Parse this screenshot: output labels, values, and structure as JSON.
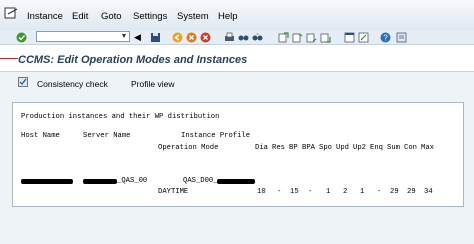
{
  "menubar": {
    "items": [
      "Instance",
      "Edit",
      "Goto",
      "Settings",
      "System",
      "Help"
    ]
  },
  "toolbar": {
    "command_field_value": ""
  },
  "title": "CCMS: Edit Operation Modes and Instances",
  "app_toolbar": {
    "consistency_check": "Consistency check",
    "profile_view": "Profile view"
  },
  "list": {
    "heading": "Production instances and their WP distribution",
    "col_host": "Host Name",
    "col_server": "Server Name",
    "col_instance_profile": "Instance Profile",
    "col_operation_mode": "Operation Mode",
    "wp_headers": [
      "Dia",
      "Res",
      "BP",
      "BPA",
      "Spo",
      "Upd",
      "Up2",
      "Enq",
      "Sum",
      "Con",
      "Max"
    ],
    "row": {
      "server_suffix": "_QAS_00",
      "profile_prefix": "QAS_D00_",
      "operation_mode": "DAYTIME",
      "values": [
        "10",
        "-",
        "15",
        "-",
        "1",
        "2",
        "1",
        "-",
        "29",
        "29",
        "34"
      ]
    }
  },
  "colors": {
    "title": "#27415e",
    "menubar": "#eef3f8"
  }
}
